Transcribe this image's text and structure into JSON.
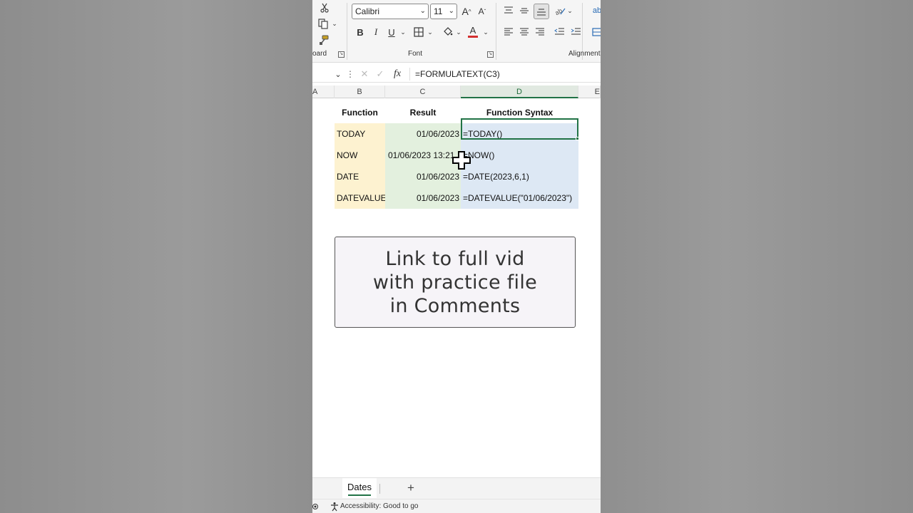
{
  "ribbon": {
    "clipboard_label_partial": "oard",
    "font_name": "Calibri",
    "font_size": "11",
    "font_group_label": "Font",
    "alignment_group_label": "Alignment",
    "bold_label": "B",
    "italic_label": "I",
    "underline_label": "U",
    "font_color_label": "A",
    "grow_label": "A",
    "shrink_label": "A",
    "wrap_partial": "ab"
  },
  "formula_bar": {
    "fx_label": "fx",
    "formula": "=FORMULATEXT(C3)"
  },
  "columns": [
    "A",
    "B",
    "C",
    "D",
    "E"
  ],
  "table": {
    "headers": {
      "function": "Function",
      "result": "Result",
      "syntax": "Function Syntax"
    },
    "rows": [
      {
        "function": "TODAY",
        "result": "01/06/2023",
        "syntax": "=TODAY()"
      },
      {
        "function": "NOW",
        "result": "01/06/2023 13:21",
        "syntax": "=NOW()"
      },
      {
        "function": "DATE",
        "result": "01/06/2023",
        "syntax": "=DATE(2023,6,1)"
      },
      {
        "function": "DATEVALUE",
        "result": "01/06/2023",
        "syntax": "=DATEVALUE(\"01/06/2023\")"
      }
    ]
  },
  "promo": {
    "line1": "Link to full vid",
    "line2": "with practice file",
    "line3": "in Comments"
  },
  "sheets": {
    "active": "Dates",
    "add_label": "+"
  },
  "status": {
    "accessibility": "Accessibility: Good to go"
  },
  "colors": {
    "excel_green": "#217346",
    "function_col": "#fdf2d0",
    "result_col": "#e3f0de",
    "syntax_col": "#dde8f4"
  }
}
